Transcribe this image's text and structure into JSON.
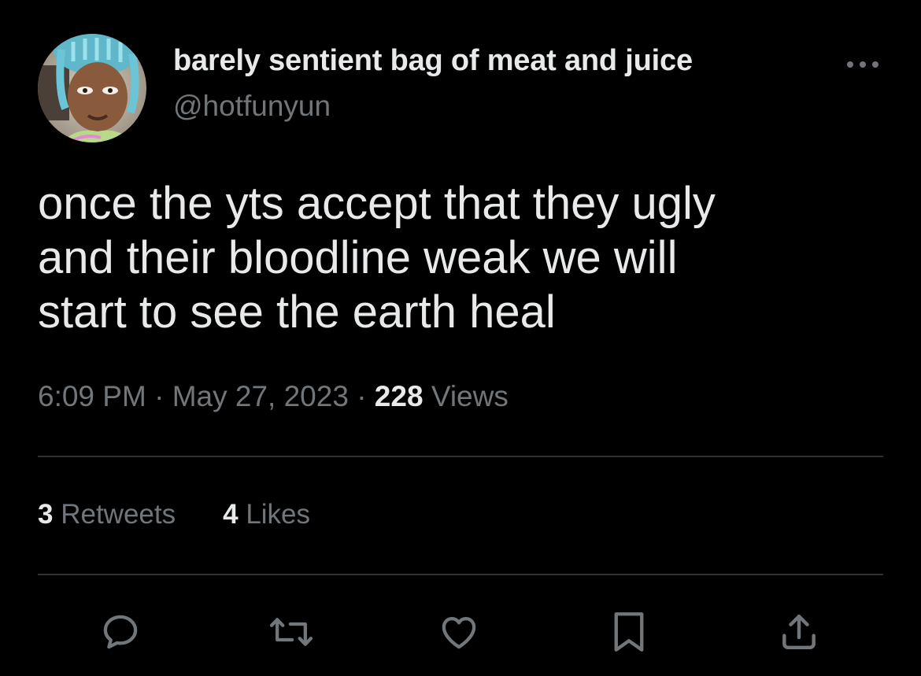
{
  "user": {
    "display_name": "barely sentient bag of meat and juice",
    "handle": "@hotfunyun",
    "avatar_icon": "profile-photo-avatar"
  },
  "header": {
    "more_icon": "more-horizontal-icon"
  },
  "tweet": {
    "text": "once the yts accept that they ugly\nand their bloodline weak we will\nstart to see the earth heal"
  },
  "meta": {
    "time": "6:09 PM",
    "separator": "·",
    "date": "May 27, 2023",
    "views_count": "228",
    "views_label": "Views"
  },
  "stats": {
    "retweets_count": "3",
    "retweets_label": "Retweets",
    "likes_count": "4",
    "likes_label": "Likes"
  },
  "actions": [
    {
      "name": "reply",
      "icon": "reply-icon"
    },
    {
      "name": "retweet",
      "icon": "retweet-icon"
    },
    {
      "name": "like",
      "icon": "heart-icon"
    },
    {
      "name": "bookmark",
      "icon": "bookmark-icon"
    },
    {
      "name": "share",
      "icon": "share-icon"
    }
  ],
  "colors": {
    "background": "#000000",
    "primary_text": "#e7e9ea",
    "secondary_text": "#71767b",
    "divider": "#2f3336"
  }
}
